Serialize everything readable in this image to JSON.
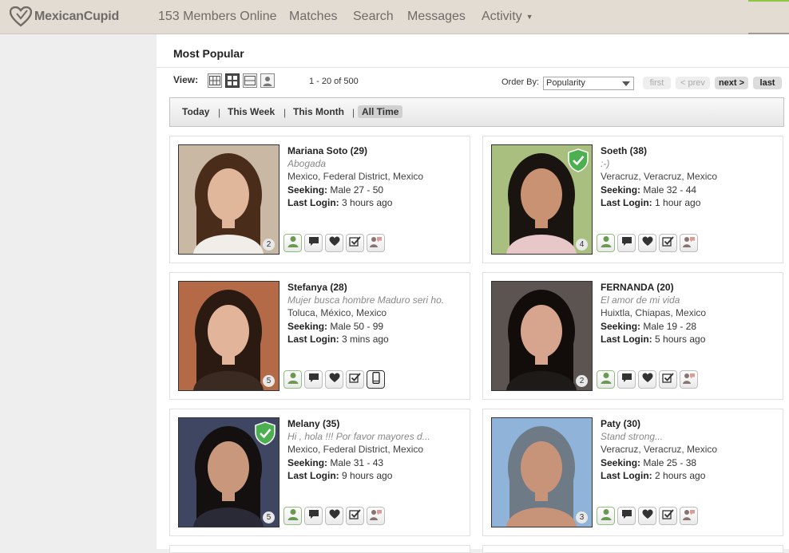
{
  "header": {
    "logo_text": "MexicanCupid",
    "nav": {
      "members_online": "153 Members Online",
      "matches": "Matches",
      "search": "Search",
      "messages": "Messages",
      "activity": "Activity"
    }
  },
  "page": {
    "title": "Most Popular",
    "view_label": "View:",
    "range": "1 - 20 of 500",
    "order_by_label": "Order By:",
    "order_by_value": "Popularity",
    "pagination": {
      "first": "first",
      "prev": "< prev",
      "next": "next >",
      "last": "last"
    }
  },
  "timeframes": [
    "Today",
    "This Week",
    "This Month",
    "All Time"
  ],
  "timeframe_separator": "|",
  "seeking_label": "Seeking:",
  "last_login_label": "Last Login:",
  "profiles": [
    {
      "name": "Mariana Soto (29)",
      "tagline": "Abogada",
      "location": "Mexico, Federal District, Mexico",
      "seeking": "Male 27 - 50",
      "last_login": "3 hours ago",
      "photos": "2",
      "verified": false,
      "bg": "#c9b8a3",
      "hair": "#4a2c1a",
      "skin": "#e0b79a",
      "shirt": "#f1ede8"
    },
    {
      "name": "Soeth (38)",
      "tagline": ":-)",
      "location": "Veracruz, Veracruz, Mexico",
      "seeking": "Male 32 - 44",
      "last_login": "1 hour ago",
      "photos": "4",
      "verified": true,
      "bg": "#a9bf7f",
      "hair": "#1a1410",
      "skin": "#c99272",
      "shirt": "#e8c7c9"
    },
    {
      "name": "Stefanya (28)",
      "tagline": "Mujer busca hombre Maduro seri ho.",
      "location": "Toluca, México, Mexico",
      "seeking": "Male 50 - 99",
      "last_login": "3 mins ago",
      "photos": "5",
      "verified": false,
      "bg": "#b56a47",
      "hair": "#2a1a12",
      "skin": "#e2b49a",
      "shirt": "#3a2a22"
    },
    {
      "name": "FERNANDA (20)",
      "tagline": "El amor de mi vida",
      "location": "Huixtla, Chiapas, Mexico",
      "seeking": "Male 19 - 28",
      "last_login": "5 hours ago",
      "photos": "2",
      "verified": false,
      "bg": "#5b5450",
      "hair": "#120c0a",
      "skin": "#d7a58e",
      "shirt": "#1e1a18"
    },
    {
      "name": "Melany (35)",
      "tagline": "Hi , hola !!! Por favor mayores d...",
      "location": "Mexico, Federal District, Mexico",
      "seeking": "Male 31 - 43",
      "last_login": "9 hours ago",
      "photos": "5",
      "verified": true,
      "bg": "#3f4662",
      "hair": "#141010",
      "skin": "#c9977b",
      "shirt": "#2a2a36"
    },
    {
      "name": "Paty (30)",
      "tagline": "Stand strong...",
      "location": "Veracruz, Veracruz, Mexico",
      "seeking": "Male 25 - 38",
      "last_login": "2 hours ago",
      "photos": "3",
      "verified": false,
      "bg": "#8fb3d9",
      "hair": "#6e7a86",
      "skin": "#c79479",
      "shirt": "#c79479"
    }
  ],
  "colors": {
    "topbar": "#e3dcd3",
    "accent_green": "#8ec63f",
    "verified_green": "#4caf50"
  }
}
